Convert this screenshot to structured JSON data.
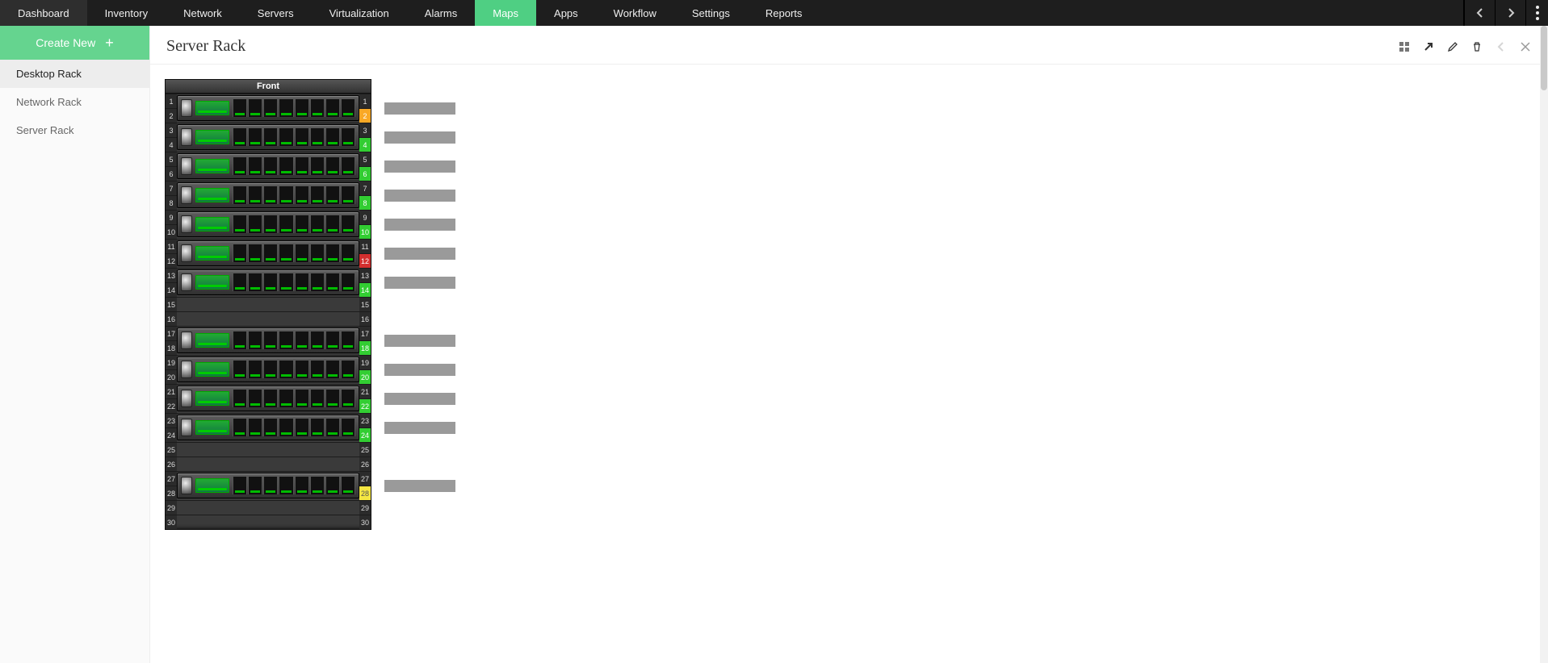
{
  "nav": {
    "items": [
      "Dashboard",
      "Inventory",
      "Network",
      "Servers",
      "Virtualization",
      "Alarms",
      "Maps",
      "Apps",
      "Workflow",
      "Settings",
      "Reports"
    ],
    "active": "Maps"
  },
  "sidebar": {
    "create_label": "Create New",
    "items": [
      {
        "label": "Desktop Rack",
        "active": true
      },
      {
        "label": "Network Rack",
        "active": false
      },
      {
        "label": "Server Rack",
        "active": false
      }
    ]
  },
  "page": {
    "title": "Server Rack"
  },
  "rack": {
    "title": "Front",
    "units": 30,
    "devices": [
      {
        "start": 1,
        "span": 2
      },
      {
        "start": 3,
        "span": 2
      },
      {
        "start": 5,
        "span": 2
      },
      {
        "start": 7,
        "span": 2
      },
      {
        "start": 9,
        "span": 2
      },
      {
        "start": 11,
        "span": 2
      },
      {
        "start": 13,
        "span": 2
      },
      {
        "start": 17,
        "span": 2
      },
      {
        "start": 19,
        "span": 2
      },
      {
        "start": 21,
        "span": 2
      },
      {
        "start": 23,
        "span": 2
      },
      {
        "start": 27,
        "span": 2
      }
    ],
    "status": {
      "2": "trouble",
      "4": "clear",
      "6": "clear",
      "8": "clear",
      "10": "clear",
      "12": "critical",
      "14": "clear",
      "18": "clear",
      "20": "clear",
      "22": "clear",
      "24": "clear",
      "28": "attention"
    }
  },
  "colors": {
    "accent": "#4fcf83"
  }
}
